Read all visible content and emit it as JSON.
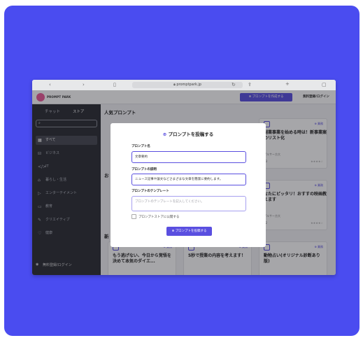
{
  "browser": {
    "url": "promptpark.jp"
  },
  "app_header": {
    "logo_text": "PROMPT PARK",
    "create_button": "⊕ プロンプトを作成する",
    "login_button": "無料登録/ログイン"
  },
  "sidebar": {
    "tabs": [
      "チャット",
      "ストア"
    ],
    "search_icon": "search-icon",
    "items": [
      {
        "label": "すべて",
        "icon": "grid-icon",
        "active": true
      },
      {
        "label": "ビジネス",
        "icon": "briefcase-icon"
      },
      {
        "label": "IT",
        "icon": "code-icon"
      },
      {
        "label": "暮らし・生活",
        "icon": "home-icon"
      },
      {
        "label": "エンターテイメント",
        "icon": "play-icon"
      },
      {
        "label": "教育",
        "icon": "book-icon"
      },
      {
        "label": "クリエイティブ",
        "icon": "brush-icon"
      },
      {
        "label": "健康",
        "icon": "heart-icon"
      }
    ],
    "login": "無料登録/ログイン"
  },
  "main": {
    "section1_title": "人気プロンプト",
    "section2_prefix": "お",
    "section3_prefix": "新",
    "cards_top": [
      {
        "title": "副業事業を始める時は！新事業案のリスト化",
        "author": "プルサー方大",
        "count": "23",
        "badge": "⊕ 業務"
      },
      {
        "title": "なたにピッタリ！おすすの映画教えます",
        "author": "プルサー方大",
        "count": "12",
        "badge": "⊕ 業務"
      }
    ],
    "cards_bottom": [
      {
        "title": "もう逃げない、今日から覚悟を決めて本気のダイエ...",
        "badge": "⊕ 業務"
      },
      {
        "title": "5秒で授業の内容を考えます！",
        "badge": "⊕ 業務"
      },
      {
        "title": "動物占い(オリジナル診断あり版)",
        "badge": "⊕ 業務"
      }
    ]
  },
  "modal": {
    "title": "プロンプトを投稿する",
    "name_label": "プロンプト名",
    "name_value": "文章要約",
    "desc_label": "プロンプトの説明",
    "desc_value": "ニュース記事や論文などさまざまな文章を簡潔に要約します。",
    "template_label": "プロンプトのテンプレート",
    "template_placeholder": "プロンプトのテンプレートを記入してください。",
    "store_checkbox_label": "プロンプトストアに公開する",
    "submit_button": "⊕ プロンプトを投稿する"
  },
  "colors": {
    "frame": "#4a4cf0",
    "accent": "#5a4fe0",
    "sidebar": "#2c2e35"
  }
}
